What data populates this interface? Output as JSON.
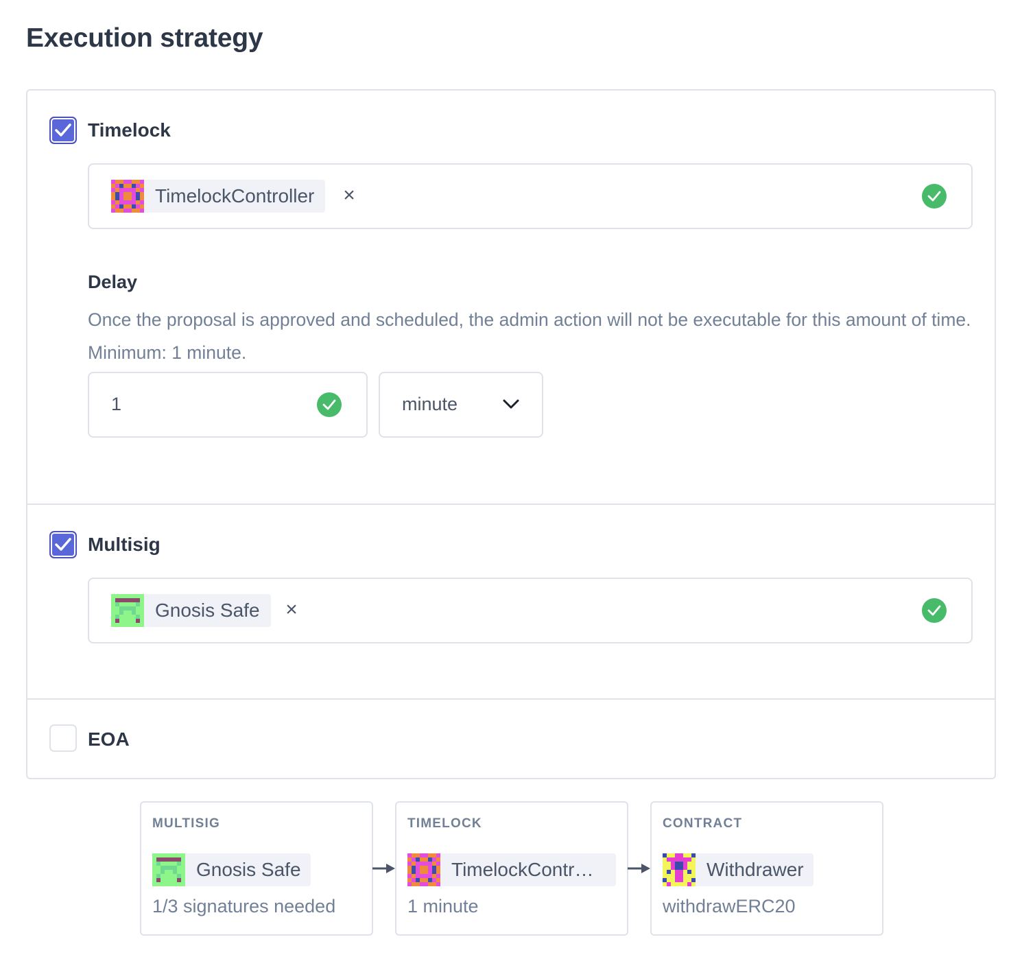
{
  "page": {
    "title": "Execution strategy"
  },
  "timelock": {
    "label": "Timelock",
    "checked": true,
    "address_name": "TimelockController",
    "remove": "×",
    "delay": {
      "title": "Delay",
      "description": "Once the proposal is approved and scheduled, the admin action will not be executable for this amount of time. Minimum: 1 minute.",
      "value": "1",
      "unit": "minute"
    }
  },
  "multisig": {
    "label": "Multisig",
    "checked": true,
    "address_name": "Gnosis Safe",
    "remove": "×"
  },
  "eoa": {
    "label": "EOA",
    "checked": false
  },
  "flow": [
    {
      "heading": "MULTISIG",
      "name": "Gnosis Safe",
      "sub": "1/3 signatures needed"
    },
    {
      "heading": "TIMELOCK",
      "name": "TimelockContr…",
      "sub": "1 minute"
    },
    {
      "heading": "CONTRACT",
      "name": "Withdrawer",
      "sub": "withdrawERC20"
    }
  ],
  "colors": {
    "accent": "#5a67d8",
    "valid": "#48bb6a",
    "border": "#dfe2e8",
    "chip_bg": "#f0f2f7"
  },
  "icons": {
    "timelock_avatar": "blockie-pink-orange-avatar",
    "safe_avatar": "blockie-green-avatar",
    "withdrawer_avatar": "blockie-yellow-magenta-avatar"
  }
}
